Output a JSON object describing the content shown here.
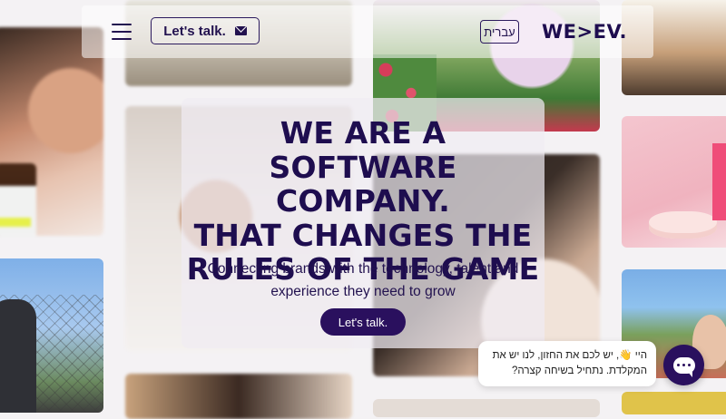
{
  "header": {
    "talk_label": "Let's talk.",
    "lang_label": "עברית",
    "logo_text": "WE>EV."
  },
  "hero": {
    "title_lines": [
      "WE ARE A SOFTWARE",
      "COMPANY.",
      "THAT CHANGES THE",
      "RULES OF THE GAME"
    ],
    "subtitle_lines": [
      "Connecting brands with the technology, talent and",
      "experience they need to grow"
    ],
    "cta_label": "Let's talk."
  },
  "chat": {
    "bubble_lines": [
      "היי 👋, יש לכם את החזון, לנו יש את",
      "המקלדת. נתחיל בשיחה קצרה?"
    ]
  },
  "colors": {
    "brand": "#1e0d4f",
    "button": "#2a105e"
  }
}
